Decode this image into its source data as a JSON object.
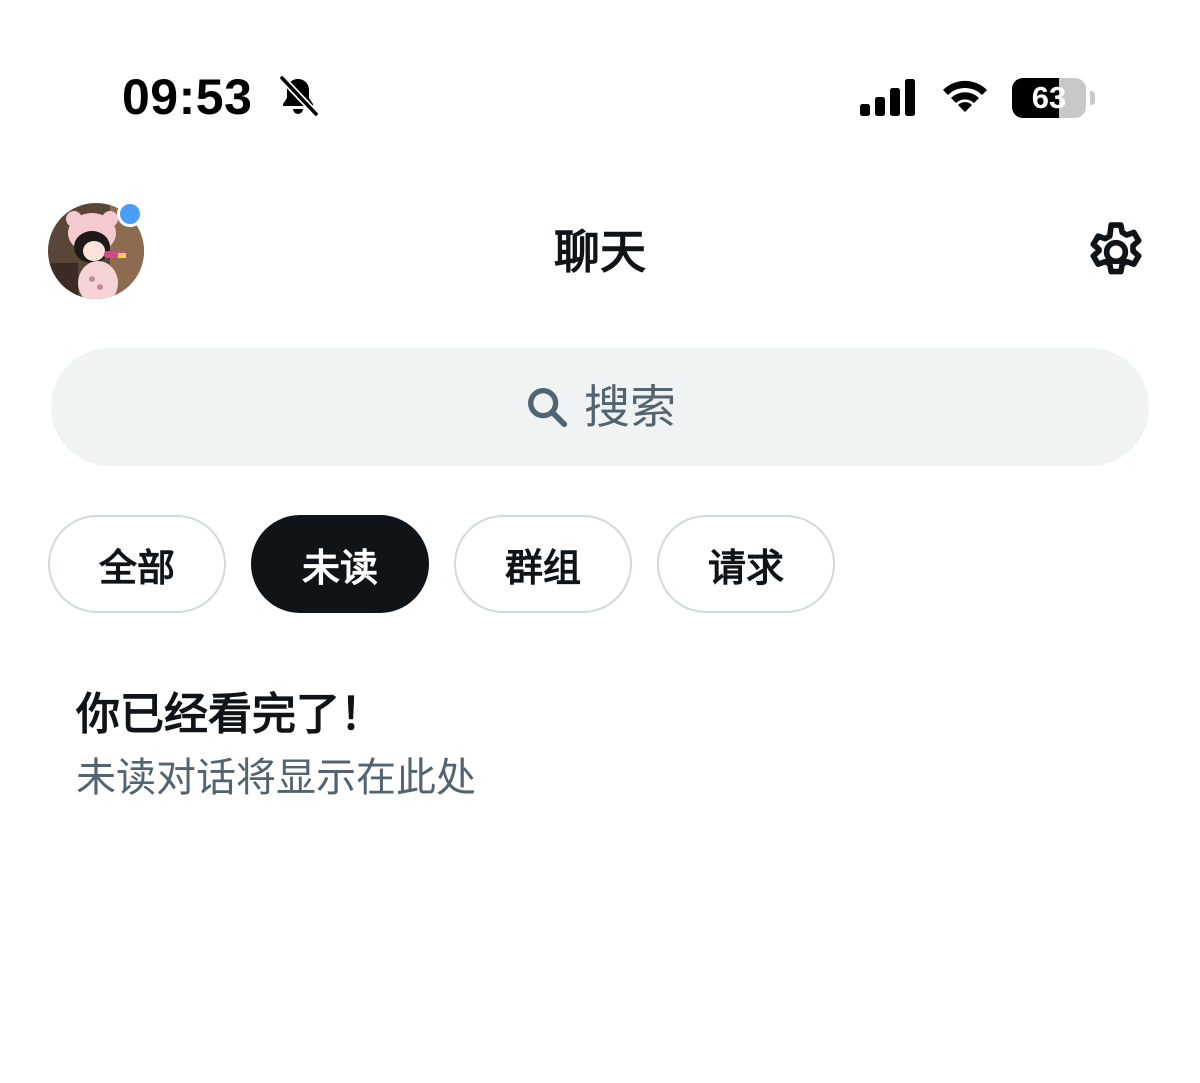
{
  "status_bar": {
    "time": "09:53",
    "battery_level": "63",
    "battery_fraction": 0.63
  },
  "header": {
    "title": "聊天",
    "has_notification": true
  },
  "search": {
    "placeholder": "搜索"
  },
  "filters": {
    "items": [
      {
        "label": "全部",
        "selected": false
      },
      {
        "label": "未读",
        "selected": true
      },
      {
        "label": "群组",
        "selected": false
      },
      {
        "label": "请求",
        "selected": false
      }
    ]
  },
  "empty_state": {
    "title": "你已经看完了！",
    "subtitle": "未读对话将显示在此处"
  },
  "colors": {
    "text_primary": "#0f1419",
    "text_secondary": "#536471",
    "search_bg": "#eff3f4",
    "tab_border": "#cfd9de",
    "notification_dot": "#4a9ef5"
  },
  "icons": {
    "status": [
      "bell-muted-icon",
      "signal-icon",
      "wifi-icon",
      "battery-icon"
    ],
    "header": [
      "avatar",
      "gear-icon"
    ],
    "search": "search-icon"
  }
}
